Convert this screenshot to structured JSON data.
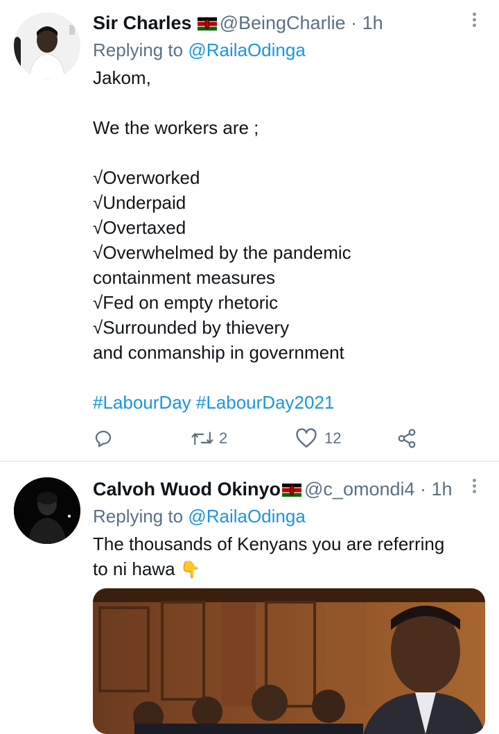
{
  "tweets": [
    {
      "name": "Sir Charles",
      "handle": "@BeingCharlie",
      "time": "· 1h",
      "replying_prefix": "Replying to ",
      "replying_to": "@RailaOdinga",
      "body_lines": [
        "Jakom,",
        "",
        "We the workers are ;",
        "",
        "√Overworked",
        "√Underpaid",
        "√Overtaxed",
        "√Overwhelmed by the pandemic",
        "containment measures",
        "√Fed on empty rhetoric",
        "√Surrounded by thievery",
        "and conmanship in government",
        ""
      ],
      "hashtags": "#LabourDay #LabourDay2021",
      "actions": {
        "reply_count": "",
        "retweet_count": "2",
        "like_count": "12"
      },
      "icons": [
        "reply-icon",
        "retweet-icon",
        "like-icon",
        "share-icon",
        "more-options-icon",
        "kenya-flag-icon"
      ]
    },
    {
      "name": "Calvoh Wuod Okinyo",
      "handle": "@c_omondi4",
      "time": "· 1h",
      "replying_prefix": "Replying to ",
      "replying_to": "@RailaOdinga",
      "body_lines": [
        "The thousands of Kenyans you are referring",
        "to ni hawa"
      ],
      "emoji": "👇",
      "icons": [
        "more-options-icon",
        "kenya-flag-icon",
        "pointing-down-emoji"
      ]
    }
  ],
  "colors": {
    "link": "#1b95e0",
    "secondary": "#5b7083",
    "text": "#0f1419",
    "divider": "#e6ecf0"
  }
}
